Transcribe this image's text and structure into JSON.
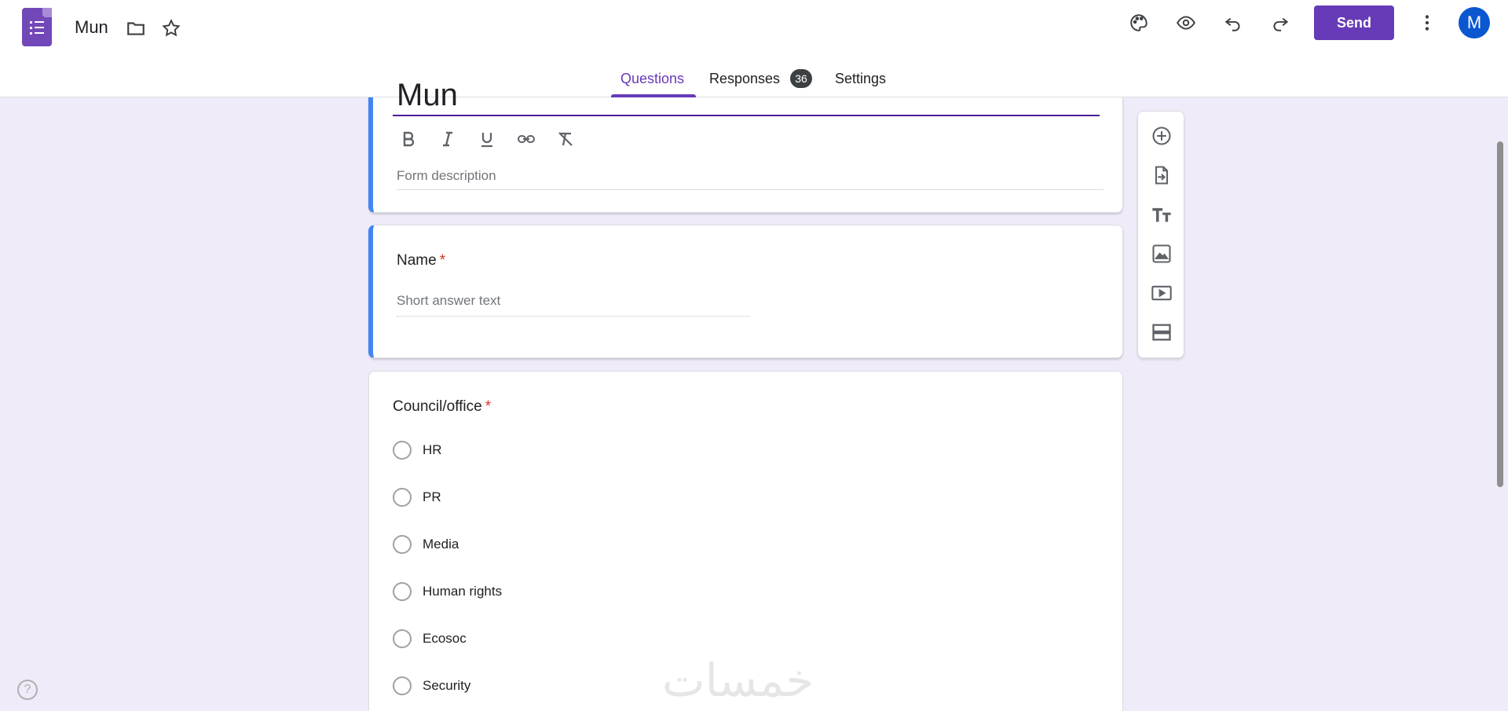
{
  "header": {
    "doc_title": "Mun",
    "send_label": "Send",
    "avatar_letter": "M",
    "icons": [
      "forms-app-icon",
      "folder-icon",
      "star-icon",
      "palette-icon",
      "eye-icon",
      "undo-icon",
      "redo-icon",
      "more-vert-icon"
    ]
  },
  "tabs": {
    "questions": "Questions",
    "responses": "Responses",
    "responses_count": "36",
    "settings": "Settings"
  },
  "title_card": {
    "title_partial": "Mun",
    "description_placeholder": "Form description",
    "format_icons": [
      "bold-icon",
      "italic-icon",
      "underline-icon",
      "link-icon",
      "clear-format-icon"
    ]
  },
  "questions": [
    {
      "title": "Name",
      "required_mark": "*",
      "placeholder": "Short answer text"
    },
    {
      "title": "Council/office",
      "required_mark": "*",
      "options": [
        "HR",
        "PR",
        "Media",
        "Human rights",
        "Ecosoc",
        "Security"
      ]
    }
  ],
  "side_toolbar": [
    "add-question-icon",
    "import-questions-icon",
    "add-title-icon",
    "add-image-icon",
    "add-video-icon",
    "add-section-icon"
  ],
  "colors": {
    "accent": "#673ab7",
    "background": "#f0ebf8",
    "focus_border": "#4285f4"
  }
}
